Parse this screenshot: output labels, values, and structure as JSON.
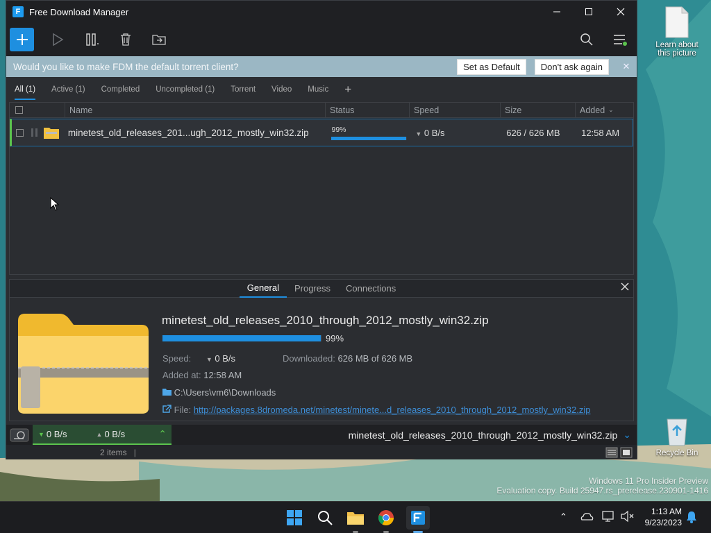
{
  "desktop": {
    "icons": [
      {
        "label": "Learn about this picture"
      },
      {
        "label": "Recycle Bin"
      }
    ],
    "watermark_line1": "Windows 11 Pro Insider Preview",
    "watermark_line2": "Evaluation copy. Build 25947.rs_prerelease.230901-1416"
  },
  "window": {
    "title": "Free Download Manager"
  },
  "banner": {
    "text": "Would you like to make FDM the default torrent client?",
    "set_default": "Set as Default",
    "dont_ask": "Don't ask again",
    "close": "✕"
  },
  "tabs": [
    "All (1)",
    "Active (1)",
    "Completed",
    "Uncompleted (1)",
    "Torrent",
    "Video",
    "Music"
  ],
  "columns": {
    "name": "Name",
    "status": "Status",
    "speed": "Speed",
    "size": "Size",
    "added": "Added"
  },
  "download": {
    "name": "minetest_old_releases_201...ugh_2012_mostly_win32.zip",
    "status_pct": "99%",
    "progress": 0.99,
    "speed": "0 B/s",
    "size": "626 / 626 MB",
    "added": "12:58 AM"
  },
  "details": {
    "tabs": [
      "General",
      "Progress",
      "Connections"
    ],
    "filename": "minetest_old_releases_2010_through_2012_mostly_win32.zip",
    "progress_pct": "99%",
    "speed_label": "Speed:",
    "speed_value": "0 B/s",
    "downloaded_label": "Downloaded:",
    "downloaded_value": "626 MB of 626 MB",
    "added_label": "Added at:",
    "added_value": "12:58 AM",
    "folder": "C:\\Users\\vm6\\Downloads",
    "file_label": "File:",
    "file_url": "http://packages.8dromeda.net/minetest/minete...d_releases_2010_through_2012_mostly_win32.zip"
  },
  "statusbar": {
    "down_speed": "0 B/s",
    "up_speed": "0 B/s",
    "current_file": "minetest_old_releases_2010_through_2012_mostly_win32.zip",
    "items_count": "2 items"
  },
  "taskbar": {
    "time": "1:13 AM",
    "date": "9/23/2023"
  },
  "colors": {
    "accent": "#1e8fe0",
    "active_green": "#5cc44e",
    "banner_bg": "#9bb7c4"
  }
}
